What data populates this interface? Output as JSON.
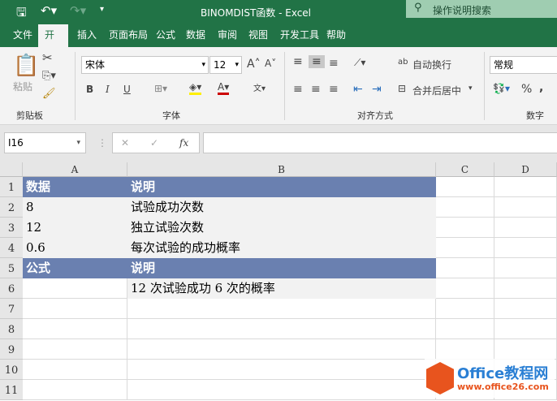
{
  "title": "BINOMDIST函数  -  Excel",
  "search_placeholder": "操作说明搜索",
  "tabs": [
    "文件",
    "开始",
    "插入",
    "页面布局",
    "公式",
    "数据",
    "审阅",
    "视图",
    "开发工具",
    "帮助"
  ],
  "ribbon": {
    "paste": "粘贴",
    "clipboard": "剪贴板",
    "font_group": "字体",
    "align_group": "对齐方式",
    "number_group": "数字",
    "font_name": "宋体",
    "font_size": "12",
    "wrap": "自动换行",
    "merge": "合并后居中",
    "number_format": "常规",
    "bold": "B",
    "italic": "I",
    "underline": "U",
    "percent": "%",
    "comma": ","
  },
  "formula_bar": {
    "name_box": "I16",
    "fx": "fx",
    "value": ""
  },
  "columns": [
    "A",
    "B",
    "C",
    "D"
  ],
  "rows": [
    "1",
    "2",
    "3",
    "4",
    "5",
    "6",
    "7",
    "8",
    "9",
    "10",
    "11"
  ],
  "cells": [
    {
      "a": "数据",
      "b": "说明",
      "style": "hdr"
    },
    {
      "a": "8",
      "b": "试验成功次数",
      "style": "fill"
    },
    {
      "a": "12",
      "b": "独立试验次数",
      "style": "fill"
    },
    {
      "a": "0.6",
      "b": "每次试验的成功概率",
      "style": "fill"
    },
    {
      "a": "公式",
      "b": "说明",
      "style": "hdr"
    },
    {
      "a": "",
      "b": "12 次试验成功 6 次的概率",
      "style": "fill6"
    }
  ],
  "watermark": {
    "brand": "Office教程网",
    "url": "www.office26.com"
  },
  "colors": {
    "green": "#217346",
    "header": "#6a80b0",
    "fill": "#f2f2f2"
  }
}
